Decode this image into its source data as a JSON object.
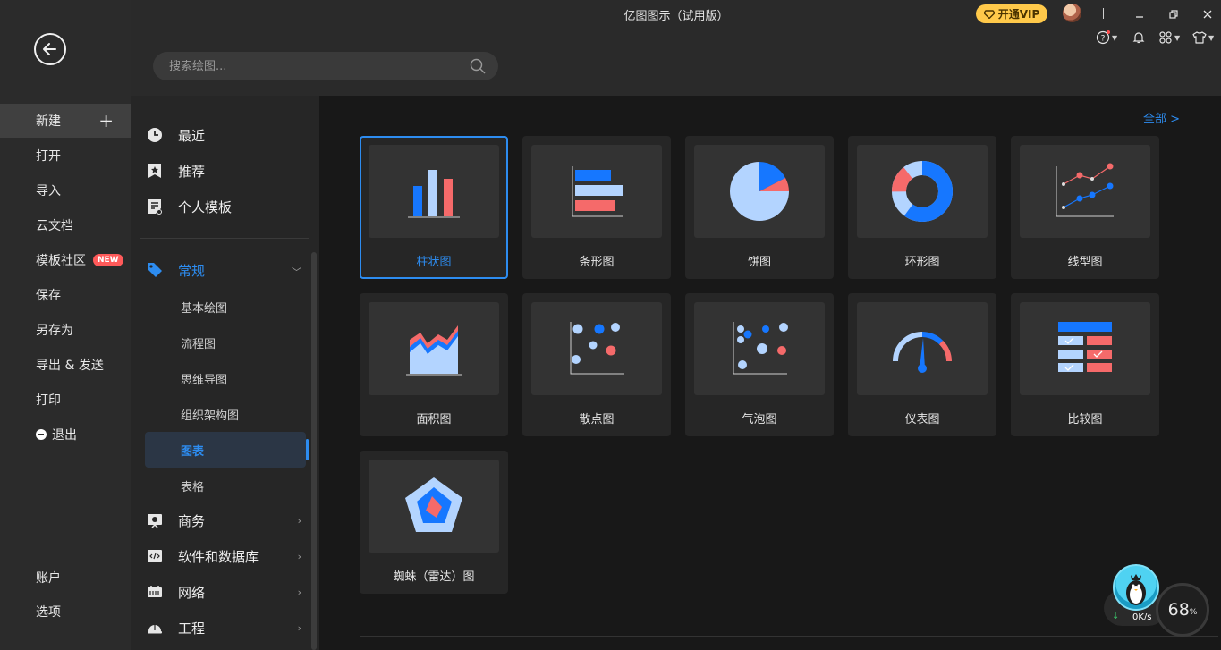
{
  "window": {
    "title": "亿图图示（试用版）",
    "vip_label": "开通VIP"
  },
  "search": {
    "placeholder": "搜索绘图..."
  },
  "rail": {
    "items": [
      {
        "label": "新建"
      },
      {
        "label": "打开"
      },
      {
        "label": "导入"
      },
      {
        "label": "云文档"
      },
      {
        "label": "模板社区",
        "badge": "NEW"
      },
      {
        "label": "保存"
      },
      {
        "label": "另存为"
      },
      {
        "label": "导出 & 发送"
      },
      {
        "label": "打印"
      },
      {
        "label": "退出"
      }
    ],
    "bottom": [
      {
        "label": "账户"
      },
      {
        "label": "选项"
      }
    ]
  },
  "categories": {
    "top": [
      {
        "label": "最近",
        "icon": "clock-icon"
      },
      {
        "label": "推荐",
        "icon": "star-icon"
      },
      {
        "label": "个人模板",
        "icon": "template-icon"
      }
    ],
    "general": {
      "label": "常规",
      "icon": "tag-icon"
    },
    "sub": [
      {
        "label": "基本绘图"
      },
      {
        "label": "流程图"
      },
      {
        "label": "思维导图"
      },
      {
        "label": "组织架构图"
      },
      {
        "label": "图表"
      },
      {
        "label": "表格"
      }
    ],
    "more": [
      {
        "label": "商务",
        "icon": "business-icon"
      },
      {
        "label": "软件和数据库",
        "icon": "code-icon"
      },
      {
        "label": "网络",
        "icon": "network-icon"
      },
      {
        "label": "工程",
        "icon": "helmet-icon"
      }
    ]
  },
  "main": {
    "all_link": "全部 >",
    "cards": [
      {
        "label": "柱状图"
      },
      {
        "label": "条形图"
      },
      {
        "label": "饼图"
      },
      {
        "label": "环形图"
      },
      {
        "label": "线型图"
      },
      {
        "label": "面积图"
      },
      {
        "label": "散点图"
      },
      {
        "label": "气泡图"
      },
      {
        "label": "仪表图"
      },
      {
        "label": "比较图"
      },
      {
        "label": "蜘蛛（雷达）图"
      }
    ]
  },
  "widgets": {
    "net_speed": "0K/s",
    "gauge_value": "68",
    "gauge_unit": "%"
  },
  "colors": {
    "accent": "#2d8cf0",
    "vip": "#ffc94a",
    "chart_blue": "#1677ff",
    "chart_light": "#b3d4ff",
    "chart_red": "#f56a6a"
  }
}
